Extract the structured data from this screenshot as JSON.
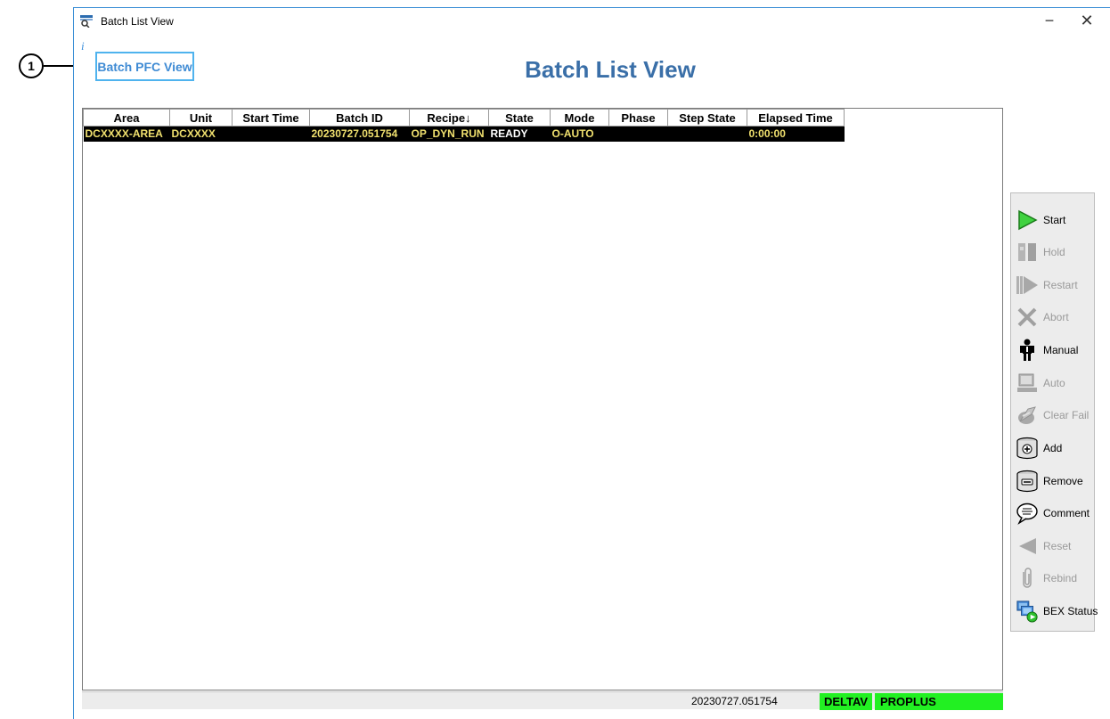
{
  "callout": {
    "number": "1"
  },
  "window": {
    "title": "Batch List View",
    "minimize_glyph": "−",
    "close_glyph": "✕",
    "info_glyph": "i"
  },
  "pfc_button": {
    "label": "Batch PFC View"
  },
  "main_title": "Batch List View",
  "table": {
    "columns": [
      "Area",
      "Unit",
      "Start Time",
      "Batch ID",
      "Recipe↓",
      "State",
      "Mode",
      "Phase",
      "Step State",
      "Elapsed Time"
    ],
    "rows": [
      {
        "area": "DCXXXX-AREA",
        "unit": "DCXXXX",
        "start_time": "",
        "batch_id": "20230727.051754",
        "recipe": "OP_DYN_RUN",
        "state": "READY",
        "mode": "O-AUTO",
        "phase": "",
        "step_state": "",
        "elapsed_time": "0:00:00"
      }
    ]
  },
  "toolbar": {
    "items": [
      {
        "label": "Start",
        "icon": "play-icon",
        "enabled": true
      },
      {
        "label": "Hold",
        "icon": "hold-icon",
        "enabled": false
      },
      {
        "label": "Restart",
        "icon": "restart-icon",
        "enabled": false
      },
      {
        "label": "Abort",
        "icon": "abort-x-icon",
        "enabled": false
      },
      {
        "label": "Manual",
        "icon": "person-icon",
        "enabled": true
      },
      {
        "label": "Auto",
        "icon": "computer-icon",
        "enabled": false
      },
      {
        "label": "Clear Fail",
        "icon": "clear-fail-icon",
        "enabled": false
      },
      {
        "label": "Add",
        "icon": "add-cylinder-icon",
        "enabled": true
      },
      {
        "label": "Remove",
        "icon": "remove-cylinder-icon",
        "enabled": true
      },
      {
        "label": "Comment",
        "icon": "comment-icon",
        "enabled": true
      },
      {
        "label": "Reset",
        "icon": "reset-icon",
        "enabled": false
      },
      {
        "label": "Rebind",
        "icon": "paperclip-icon",
        "enabled": false
      },
      {
        "label": "BEX Status",
        "icon": "bex-status-icon",
        "enabled": true
      }
    ]
  },
  "status_bar": {
    "batch_id": "20230727.051754",
    "system": "DELTAV",
    "node": "PROPLUS"
  },
  "colors": {
    "accent": "#3a6fa8",
    "row_text": "#f0e06e",
    "status_green": "#22f022"
  }
}
